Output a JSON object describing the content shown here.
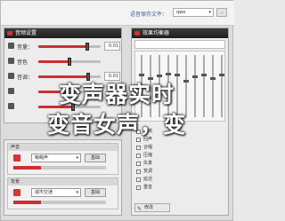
{
  "header": {
    "folder_label": "语音保存文件：",
    "folder_value": "qwe",
    "browse_button": "..."
  },
  "voice_panel": {
    "title": "音频设置",
    "rows": [
      {
        "name": "音量：",
        "value": "0.01",
        "level": 0.78
      },
      {
        "name": "音色",
        "value": "",
        "level": 0.5
      },
      {
        "name": "音调：",
        "value": "0.01",
        "level": 0.8
      },
      {
        "name": "",
        "value": "",
        "level": 0.45
      },
      {
        "name": "",
        "value": "",
        "level": 0.55
      }
    ]
  },
  "eq_panel": {
    "title": "效果均衡器",
    "preset": "",
    "bands": [
      0.3,
      0.35,
      0.32,
      0.28,
      0.3,
      0.4,
      0.33,
      0.3,
      0.35,
      0.3
    ],
    "effects": [
      "混响",
      "回声",
      "合唱",
      "压缩",
      "失真",
      "变调",
      "延迟",
      "重音"
    ],
    "edit_button": "修改"
  },
  "bottom_panel": {
    "sections": [
      {
        "title": "声音",
        "combo": "萌萌声",
        "button": "基础",
        "level": 0.3
      },
      {
        "title": "背景",
        "combo": "城市交通",
        "button": "基础",
        "level": 0.3
      }
    ]
  },
  "overlay": {
    "line1": "变声器实时",
    "line2": "变音女声，变"
  },
  "colors": {
    "accent": "#cc2f2f",
    "header_bg": "#1e1e1e"
  }
}
